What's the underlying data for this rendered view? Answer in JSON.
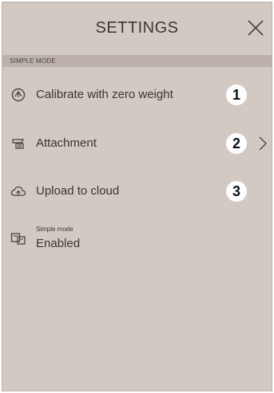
{
  "header": {
    "title": "SETTINGS",
    "close_icon": "close-icon"
  },
  "section": {
    "label": "SIMPLE MODE"
  },
  "items": [
    {
      "label": "Calibrate with zero weight",
      "icon": "calibrate-icon",
      "badge": "1"
    },
    {
      "label": "Attachment",
      "icon": "attachment-icon",
      "badge": "2",
      "chevron": "chevron-right-icon"
    },
    {
      "label": "Upload to cloud",
      "icon": "cloud-upload-icon",
      "badge": "3"
    }
  ],
  "simple_mode": {
    "label": "Simple mode",
    "value": "Enabled",
    "icon": "simple-mode-icon"
  }
}
